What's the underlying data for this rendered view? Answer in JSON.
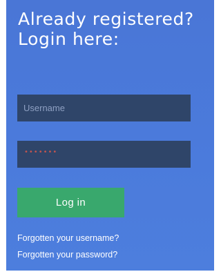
{
  "login": {
    "heading_line1": "Already registered?",
    "heading_line2": "Login here:",
    "username_placeholder": "Username",
    "password_mask": "•••••••",
    "login_button": "Log in",
    "forgot_username": "Forgotten your username?",
    "forgot_password": "Forgotten your password?"
  },
  "colors": {
    "panel_background": "#4a78d8",
    "field_background": "#2f4569",
    "button_background": "#39a86d",
    "password_mask": "#c1544f"
  }
}
